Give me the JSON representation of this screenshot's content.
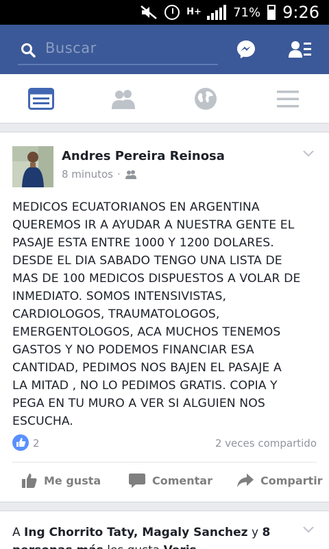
{
  "status_bar": {
    "battery_percent": "71%",
    "time": "9:26",
    "network": "H+"
  },
  "header": {
    "search_placeholder": "Buscar",
    "icons": [
      "search-icon",
      "messenger-icon",
      "friend-requests-icon"
    ],
    "color": "#3b5998"
  },
  "tabs": [
    {
      "name": "news-feed",
      "icon": "news-feed-icon",
      "active": true
    },
    {
      "name": "friends",
      "icon": "friends-icon",
      "active": false
    },
    {
      "name": "notifications",
      "icon": "globe-icon",
      "active": false
    },
    {
      "name": "menu",
      "icon": "hamburger-icon",
      "active": false
    }
  ],
  "post": {
    "author": "Andres Pereira Reinosa",
    "time": "8 minutos",
    "separator": "·",
    "audience_icon": "friends-icon",
    "text": "MEDICOS ECUATORIANOS EN ARGENTINA\nQUEREMOS IR A AYUDAR A NUESTRA GENTE EL\nPASAJE ESTA ENTRE 1000 Y 1200 DOLARES.\nDESDE EL DIA SABADO TENGO UNA LISTA DE\nMAS DE 100 MEDICOS DISPUESTOS A VOLAR DE\nINMEDIATO. SOMOS INTENSIVISTAS,\nCARDIOLOGOS, TRAUMATOLOGOS,\nEMERGENTOLOGOS, ACA MUCHOS TENEMOS\nGASTOS Y NO PODEMOS FINANCIAR ESA\nCANTIDAD, PEDIMOS NOS BAJEN EL PASAJE A\nLA MITAD , NO LO PEDIMOS GRATIS. COPIA Y\nPEGA EN TU MURO A VER SI ALGUIEN NOS\nESCUCHA.",
    "likes": "2",
    "shares": "2 veces compartido",
    "actions": {
      "like": "Me gusta",
      "comment": "Comentar",
      "share": "Compartir"
    }
  },
  "next_post": {
    "prefix": "A ",
    "names": "Ing Chorrito Taty, Magaly Sanchez",
    "middle": " y ",
    "count": "8",
    "line2_bold": "personas más",
    "line2": " les gusta ",
    "line2_end": "Veris"
  }
}
